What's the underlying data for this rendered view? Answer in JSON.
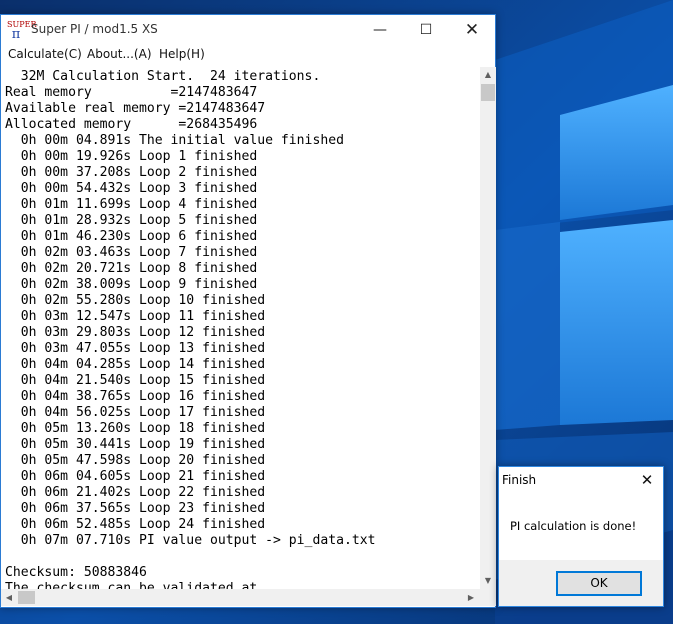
{
  "window": {
    "title": "Super PI / mod1.5 XS",
    "icon_top_label": "SUPER",
    "icon_symbol": "π",
    "minimize_glyph": "—",
    "maximize_glyph": "☐",
    "close_glyph": "✕"
  },
  "menu": {
    "items": [
      {
        "label": "Calculate(C)"
      },
      {
        "label": "About...(A)"
      },
      {
        "label": "Help(H)"
      }
    ]
  },
  "output": {
    "lines": [
      "  32M Calculation Start.  24 iterations.",
      "Real memory          =2147483647",
      "Available real memory =2147483647",
      "Allocated memory      =268435496",
      "  0h 00m 04.891s The initial value finished",
      "  0h 00m 19.926s Loop 1 finished",
      "  0h 00m 37.208s Loop 2 finished",
      "  0h 00m 54.432s Loop 3 finished",
      "  0h 01m 11.699s Loop 4 finished",
      "  0h 01m 28.932s Loop 5 finished",
      "  0h 01m 46.230s Loop 6 finished",
      "  0h 02m 03.463s Loop 7 finished",
      "  0h 02m 20.721s Loop 8 finished",
      "  0h 02m 38.009s Loop 9 finished",
      "  0h 02m 55.280s Loop 10 finished",
      "  0h 03m 12.547s Loop 11 finished",
      "  0h 03m 29.803s Loop 12 finished",
      "  0h 03m 47.055s Loop 13 finished",
      "  0h 04m 04.285s Loop 14 finished",
      "  0h 04m 21.540s Loop 15 finished",
      "  0h 04m 38.765s Loop 16 finished",
      "  0h 04m 56.025s Loop 17 finished",
      "  0h 05m 13.260s Loop 18 finished",
      "  0h 05m 30.441s Loop 19 finished",
      "  0h 05m 47.598s Loop 20 finished",
      "  0h 06m 04.605s Loop 21 finished",
      "  0h 06m 21.402s Loop 22 finished",
      "  0h 06m 37.565s Loop 23 finished",
      "  0h 06m 52.485s Loop 24 finished",
      "  0h 07m 07.710s PI value output -> pi_data.txt",
      "",
      "Checksum: 50883846",
      "The checksum can be validated at"
    ]
  },
  "scrollbars": {
    "up_glyph": "▲",
    "down_glyph": "▼",
    "left_glyph": "◀",
    "right_glyph": "▶"
  },
  "dialog": {
    "title": "Finish",
    "close_glyph": "✕",
    "message": "PI calculation is done!",
    "ok_label": "OK"
  },
  "colors": {
    "wallpaper_dark": "#0a2f6b",
    "wallpaper_light": "#2e8fe0",
    "accent": "#0078d7"
  }
}
